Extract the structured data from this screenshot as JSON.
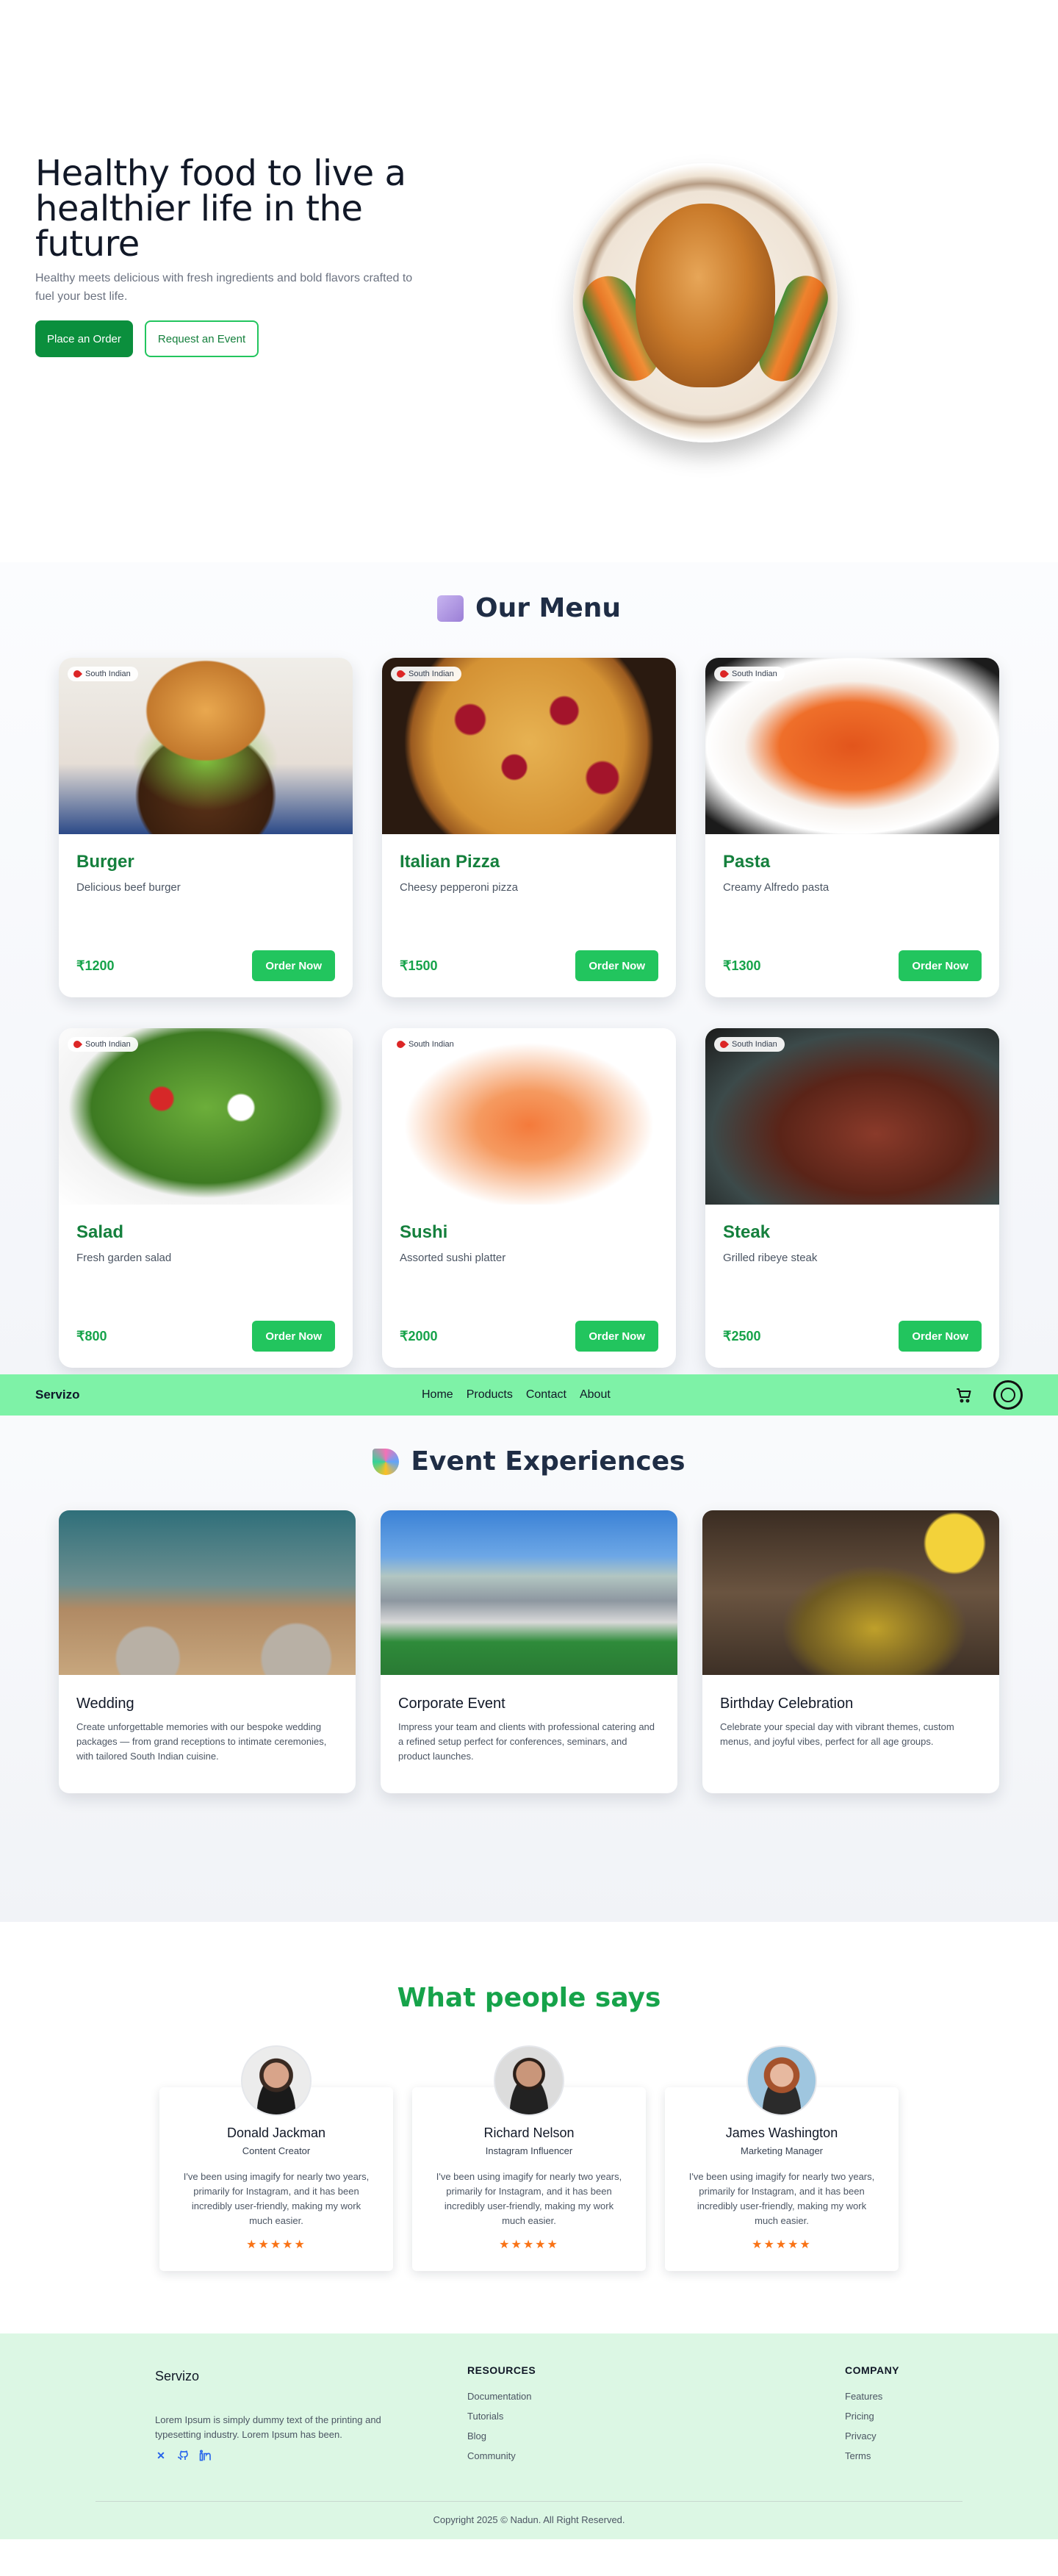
{
  "hero": {
    "title": "Healthy food to live a healthier life in the future",
    "subtitle": "Healthy meets delicious with fresh ingredients and bold flavors crafted to fuel your best life.",
    "primary_cta": "Place an Order",
    "secondary_cta": "Request an Event"
  },
  "menu": {
    "title": "Our Menu",
    "items": [
      {
        "tag": "South Indian",
        "name": "Burger",
        "desc": "Delicious beef burger",
        "price": "₹1200",
        "cta": "Order Now"
      },
      {
        "tag": "South Indian",
        "name": "Italian Pizza",
        "desc": "Cheesy pepperoni pizza",
        "price": "₹1500",
        "cta": "Order Now"
      },
      {
        "tag": "South Indian",
        "name": "Pasta",
        "desc": "Creamy Alfredo pasta",
        "price": "₹1300",
        "cta": "Order Now"
      },
      {
        "tag": "South Indian",
        "name": "Salad",
        "desc": "Fresh garden salad",
        "price": "₹800",
        "cta": "Order Now"
      },
      {
        "tag": "South Indian",
        "name": "Sushi",
        "desc": "Assorted sushi platter",
        "price": "₹2000",
        "cta": "Order Now"
      },
      {
        "tag": "South Indian",
        "name": "Steak",
        "desc": "Grilled ribeye steak",
        "price": "₹2500",
        "cta": "Order Now"
      }
    ]
  },
  "navbar": {
    "brand": "Servizo",
    "links": [
      "Home",
      "Products",
      "Contact",
      "About"
    ]
  },
  "events": {
    "title": "Event Experiences",
    "items": [
      {
        "name": "Wedding",
        "desc": "Create unforgettable memories with our bespoke wedding packages — from grand receptions to intimate ceremonies, with tailored South Indian cuisine."
      },
      {
        "name": "Corporate Event",
        "desc": "Impress your team and clients with professional catering and a refined setup perfect for conferences, seminars, and product launches."
      },
      {
        "name": "Birthday Celebration",
        "desc": "Celebrate your special day with vibrant themes, custom menus, and joyful vibes, perfect for all age groups."
      }
    ]
  },
  "testimonials": {
    "title": "What people says",
    "items": [
      {
        "name": "Donald Jackman",
        "role": "Content Creator",
        "quote": "I've been using imagify for nearly two years, primarily for Instagram, and it has been incredibly user-friendly, making my work much easier.",
        "stars": "★★★★★"
      },
      {
        "name": "Richard Nelson",
        "role": "Instagram Influencer",
        "quote": "I've been using imagify for nearly two years, primarily for Instagram, and it has been incredibly user-friendly, making my work much easier.",
        "stars": "★★★★★"
      },
      {
        "name": "James Washington",
        "role": "Marketing Manager",
        "quote": "I've been using imagify for nearly two years, primarily for Instagram, and it has been incredibly user-friendly, making my work much easier.",
        "stars": "★★★★★"
      }
    ]
  },
  "footer": {
    "brand": "Servizo",
    "about": "Lorem Ipsum is simply dummy text of the printing and typesetting industry. Lorem Ipsum has been.",
    "socials": [
      "x-icon",
      "github-icon",
      "linkedin-icon"
    ],
    "resources": {
      "heading": "RESOURCES",
      "links": [
        "Documentation",
        "Tutorials",
        "Blog",
        "Community"
      ]
    },
    "company": {
      "heading": "COMPANY",
      "links": [
        "Features",
        "Pricing",
        "Privacy",
        "Terms"
      ]
    },
    "copyright": "Copyright 2025 © Nadun. All Right Reserved."
  },
  "colors": {
    "brand_green": "#16a34a",
    "navbar_bg": "#7ef2a7",
    "footer_bg": "#dcf7e4",
    "star": "#f97316"
  }
}
